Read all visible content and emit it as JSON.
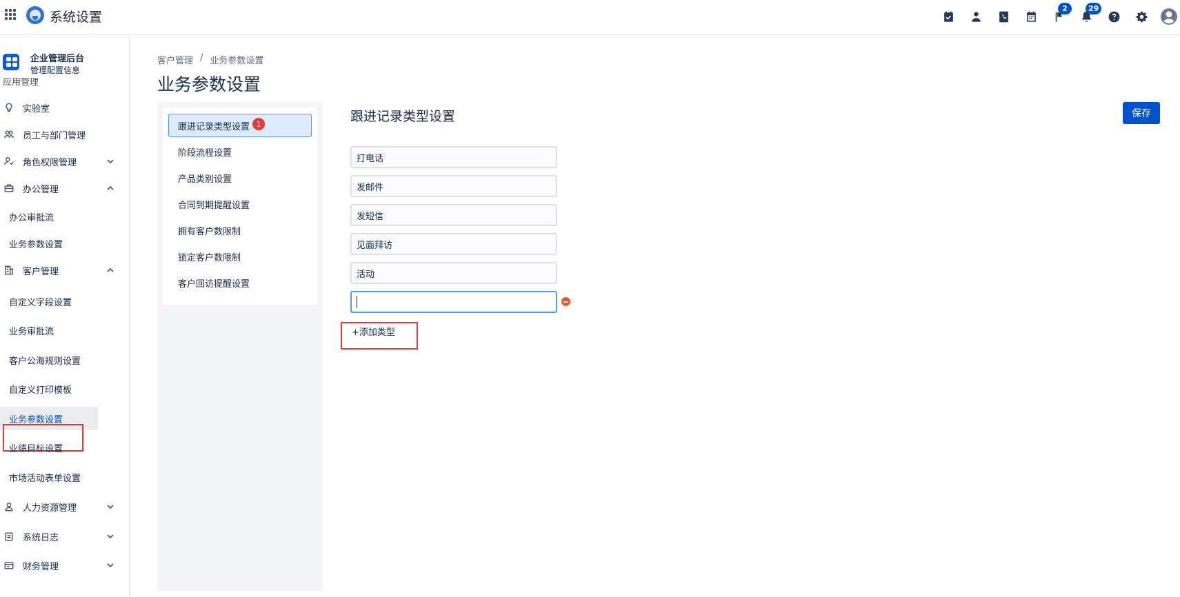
{
  "app": {
    "title": "系统设置"
  },
  "topbar": {
    "icons": [
      "calendar-check-icon",
      "person-icon",
      "phone-book-icon",
      "calendar-icon",
      "flag-icon",
      "bell-icon",
      "help-icon",
      "gear-icon",
      "avatar-icon"
    ],
    "flag_badge": "2",
    "bell_badge": "29"
  },
  "sidebar": {
    "header": {
      "title": "企业管理后台",
      "subtitle": "管理配置信息"
    },
    "partial_item": "应用管理",
    "items": [
      {
        "label": "实验室",
        "icon": "bulb-icon"
      },
      {
        "label": "员工与部门管理",
        "icon": "people-icon"
      },
      {
        "label": "角色权限管理",
        "icon": "role-icon",
        "chevron": "down"
      },
      {
        "label": "办公管理",
        "icon": "briefcase-icon",
        "chevron": "up"
      },
      {
        "label": "客户管理",
        "icon": "building-icon",
        "chevron": "up"
      },
      {
        "label": "人力资源管理",
        "icon": "person-icon",
        "chevron": "down"
      },
      {
        "label": "系统日志",
        "icon": "log-icon",
        "chevron": "down"
      },
      {
        "label": "财务管理",
        "icon": "finance-icon",
        "chevron": "down"
      }
    ],
    "office_sub": [
      "办公审批流",
      "业务参数设置"
    ],
    "customer_sub": [
      "自定义字段设置",
      "业务审批流",
      "客户公海规则设置",
      "自定义打印模板",
      "业务参数设置",
      "业绩目标设置",
      "市场活动表单设置"
    ],
    "active_item": "业务参数设置"
  },
  "breadcrumb": {
    "parent": "客户管理",
    "separator": "/",
    "current": "业务参数设置"
  },
  "page": {
    "title": "业务参数设置"
  },
  "subnav": {
    "items": [
      "跟进记录类型设置",
      "阶段流程设置",
      "产品类别设置",
      "合同到期提醒设置",
      "拥有客户数限制",
      "锁定客户数限制",
      "客户回访提醒设置"
    ],
    "badge": "1"
  },
  "section": {
    "title": "跟进记录类型设置",
    "save_label": "保存",
    "types": [
      "打电话",
      "发邮件",
      "发短信",
      "见面拜访",
      "活动"
    ],
    "new_type_value": "",
    "add_label": "+添加类型"
  },
  "colors": {
    "accent": "#0052cc",
    "highlight_box": "#e53935",
    "remove": "#f0562a"
  }
}
